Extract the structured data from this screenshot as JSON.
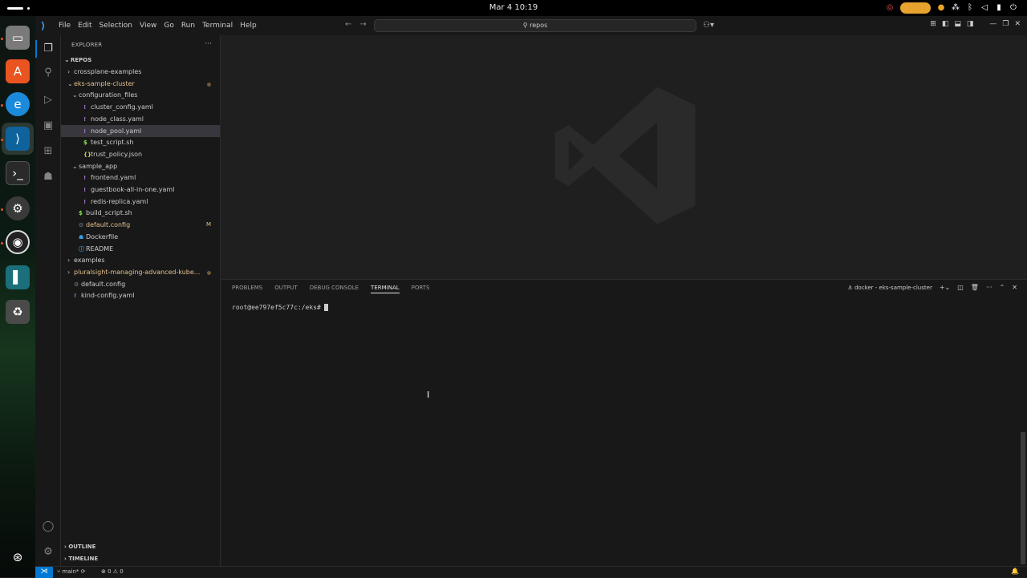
{
  "topbar": {
    "clock": "Mar 4  10:19"
  },
  "window": {
    "menus": [
      "File",
      "Edit",
      "Selection",
      "View",
      "Go",
      "Run",
      "Terminal",
      "Help"
    ],
    "search_placeholder": "repos"
  },
  "explorer": {
    "header": "EXPLORER",
    "root": "REPOS",
    "tree": [
      {
        "label": "crossplane-examples",
        "indent": 1,
        "type": "folder",
        "open": false,
        "dot": false
      },
      {
        "label": "eks-sample-cluster",
        "indent": 1,
        "type": "folder",
        "open": true,
        "modified": true,
        "dot": true
      },
      {
        "label": "configuration_files",
        "indent": 2,
        "type": "folder",
        "open": true
      },
      {
        "label": "cluster_config.yaml",
        "indent": 3,
        "type": "yaml"
      },
      {
        "label": "node_class.yaml",
        "indent": 3,
        "type": "yaml"
      },
      {
        "label": "node_pool.yaml",
        "indent": 3,
        "type": "yaml",
        "selected": true
      },
      {
        "label": "test_script.sh",
        "indent": 3,
        "type": "sh"
      },
      {
        "label": "trust_policy.json",
        "indent": 3,
        "type": "json"
      },
      {
        "label": "sample_app",
        "indent": 2,
        "type": "folder",
        "open": true
      },
      {
        "label": "frontend.yaml",
        "indent": 3,
        "type": "yaml"
      },
      {
        "label": "guestbook-all-in-one.yaml",
        "indent": 3,
        "type": "yaml"
      },
      {
        "label": "redis-replica.yaml",
        "indent": 3,
        "type": "yaml"
      },
      {
        "label": "build_script.sh",
        "indent": 2,
        "type": "sh"
      },
      {
        "label": "default.config",
        "indent": 2,
        "type": "gear",
        "modified": true,
        "badge": "M"
      },
      {
        "label": "Dockerfile",
        "indent": 2,
        "type": "docker"
      },
      {
        "label": "README",
        "indent": 2,
        "type": "info"
      },
      {
        "label": "examples",
        "indent": 1,
        "type": "folder",
        "open": false
      },
      {
        "label": "pluralsight-managing-advanced-kube...",
        "indent": 1,
        "type": "folder",
        "open": false,
        "modified": true,
        "dot": true
      },
      {
        "label": "default.config",
        "indent": 1,
        "type": "gear"
      },
      {
        "label": "kind-config.yaml",
        "indent": 1,
        "type": "yaml"
      }
    ],
    "outline": "OUTLINE",
    "timeline": "TIMELINE"
  },
  "panel": {
    "tabs": [
      "PROBLEMS",
      "OUTPUT",
      "DEBUG CONSOLE",
      "TERMINAL",
      "PORTS"
    ],
    "active_tab": "TERMINAL",
    "terminal_name": "docker - eks-sample-cluster",
    "prompt": "root@ee797ef5c77c:/eks#"
  },
  "status": {
    "branch": "main*",
    "problems": "0 ⚠ 0"
  },
  "colors": {
    "accent": "#0078d4",
    "modified": "#e2c08d",
    "yaml": "#a074c4",
    "shell": "#89e051",
    "json": "#cbcb41",
    "docker": "#3a9bdc"
  }
}
